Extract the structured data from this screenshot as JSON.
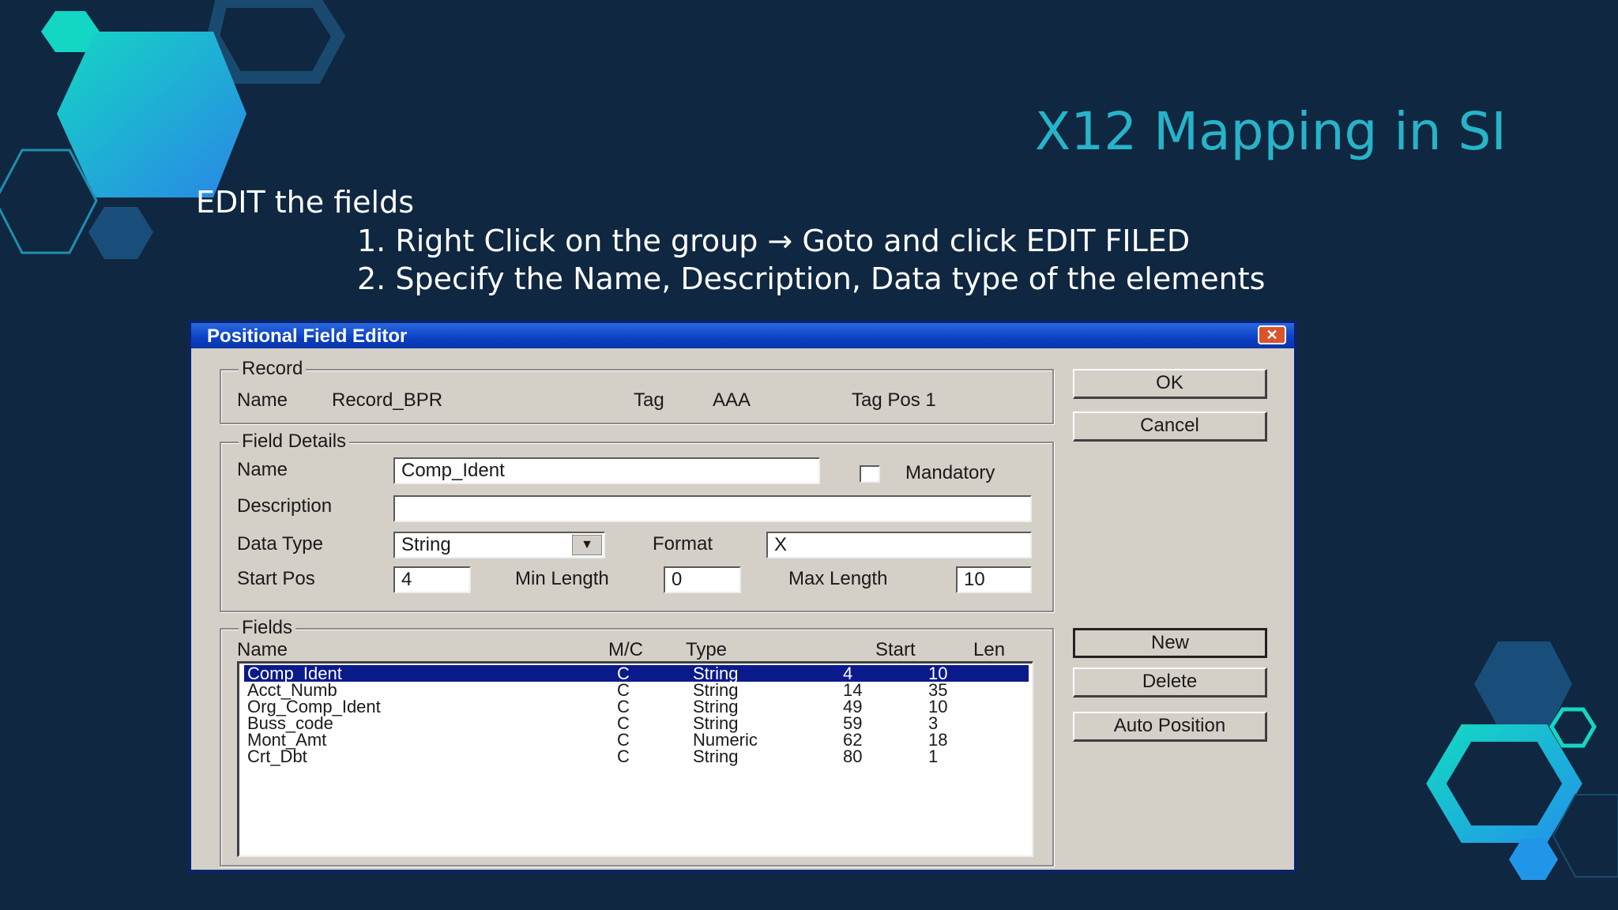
{
  "slide": {
    "title": "X12 Mapping in SI",
    "intro": "EDIT the fields",
    "steps": [
      "1. Right Click on the group → Goto and click EDIT FILED",
      "2. Specify the Name, Description, Data type of the elements"
    ]
  },
  "colors": {
    "background": "#0f2740",
    "title": "#27b3c9",
    "teal": "#14d6c4",
    "blue": "#2196e8",
    "dialog_selection": "#0a1a8a"
  },
  "dialog": {
    "title": "Positional Field Editor",
    "close_icon": "close-icon",
    "record": {
      "legend": "Record",
      "name_label": "Name",
      "name_value": "Record_BPR",
      "tag_label": "Tag",
      "tag_value": "AAA",
      "tag_pos": "Tag Pos  1"
    },
    "field_details": {
      "legend": "Field Details",
      "name_label": "Name",
      "name_value": "Comp_Ident",
      "mandatory_label": "Mandatory",
      "description_label": "Description",
      "description_value": "",
      "data_type_label": "Data Type",
      "data_type_value": "String",
      "format_label": "Format",
      "format_value": "X",
      "start_pos_label": "Start Pos",
      "start_pos_value": "4",
      "min_length_label": "Min Length",
      "min_length_value": "0",
      "max_length_label": "Max Length",
      "max_length_value": "10"
    },
    "fields": {
      "legend": "Fields",
      "headers": {
        "name": "Name",
        "mc": "M/C",
        "type": "Type",
        "start": "Start",
        "len": "Len"
      },
      "rows": [
        {
          "name": "Comp_Ident",
          "mc": "C",
          "type": "String",
          "start": "4",
          "len": "10"
        },
        {
          "name": "Acct_Numb",
          "mc": "C",
          "type": "String",
          "start": "14",
          "len": "35"
        },
        {
          "name": "Org_Comp_Ident",
          "mc": "C",
          "type": "String",
          "start": "49",
          "len": "10"
        },
        {
          "name": "Buss_code",
          "mc": "C",
          "type": "String",
          "start": "59",
          "len": "3"
        },
        {
          "name": "Mont_Amt",
          "mc": "C",
          "type": "Numeric",
          "start": "62",
          "len": "18"
        },
        {
          "name": "Crt_Dbt",
          "mc": "C",
          "type": "String",
          "start": "80",
          "len": "1"
        }
      ]
    },
    "buttons": {
      "ok": "OK",
      "cancel": "Cancel",
      "new": "New",
      "delete": "Delete",
      "auto_position": "Auto Position"
    }
  }
}
